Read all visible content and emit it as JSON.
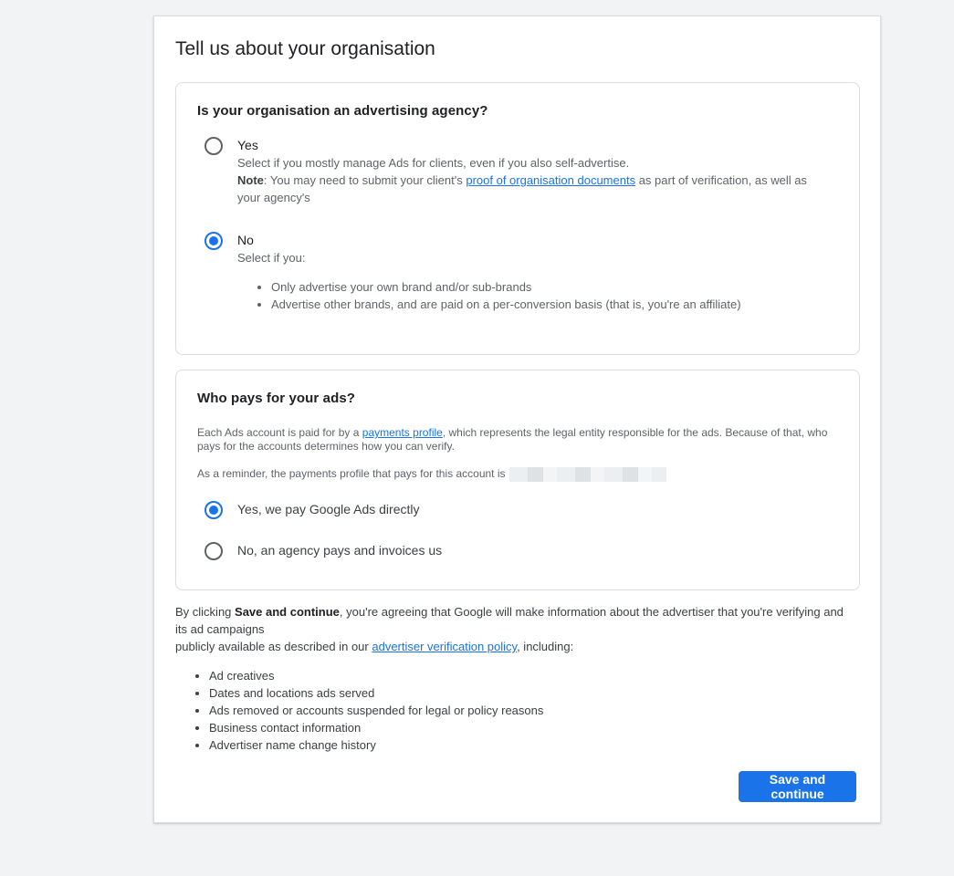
{
  "page": {
    "title": "Tell us about your organisation"
  },
  "agency_section": {
    "question": "Is your organisation an advertising agency?",
    "options": [
      {
        "label": "Yes",
        "selected": false,
        "description": "Select if you mostly manage Ads for clients, even if you also self-advertise.",
        "note_label": "Note",
        "note_text_before": ": You may need to submit your client's ",
        "note_link": "proof of organisation documents",
        "note_text_after": " as part of verification, as well as your agency's"
      },
      {
        "label": "No",
        "selected": true,
        "description": "Select if you:",
        "bullets": [
          "Only advertise your own brand and/or sub-brands",
          "Advertise other brands, and are paid on a per-conversion basis (that is, you're an affiliate)"
        ]
      }
    ]
  },
  "payer_section": {
    "question": "Who pays for your ads?",
    "info_before": "Each Ads account is paid for by a ",
    "info_link": "payments profile",
    "info_after": ", which represents the legal entity responsible for the ads. Because of that, who pays for the accounts determines how you can verify.",
    "reminder": "As a reminder, the payments profile that pays for this account is",
    "options": [
      {
        "label": "Yes, we pay Google Ads directly",
        "selected": true
      },
      {
        "label": "No, an agency pays and invoices us",
        "selected": false
      }
    ]
  },
  "consent": {
    "text_before": "By clicking ",
    "bold": "Save and continue",
    "text_middle": ", you're agreeing that Google will make information about the advertiser that you're verifying and its ad campaigns",
    "text_line2_before": "publicly available as described in our ",
    "link": "advertiser verification policy",
    "text_after": ", including:",
    "items": [
      "Ad creatives",
      "Dates and locations ads served",
      "Ads removed or accounts suspended for legal or policy reasons",
      "Business contact information",
      "Advertiser name change history"
    ]
  },
  "actions": {
    "save_label": "Save and continue"
  },
  "colors": {
    "accent": "#1a73e8",
    "background": "#f1f3f4"
  }
}
